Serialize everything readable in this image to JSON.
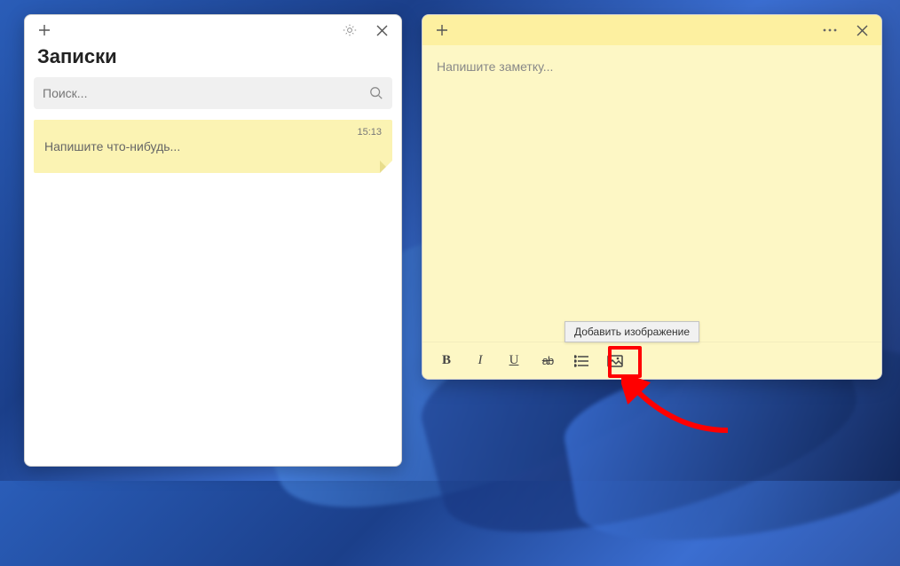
{
  "list_window": {
    "title": "Записки",
    "search_placeholder": "Поиск...",
    "notes": [
      {
        "preview": "Напишите что-нибудь...",
        "time": "15:13"
      }
    ]
  },
  "note_window": {
    "placeholder": "Напишите заметку...",
    "toolbar": {
      "bold": "B",
      "italic": "I",
      "underline": "U",
      "strike": "ab"
    },
    "tooltip_add_image": "Добавить изображение"
  },
  "colors": {
    "note_bg": "#fdf7c5",
    "note_header": "#fdf0a0",
    "highlight": "#ff0000"
  }
}
